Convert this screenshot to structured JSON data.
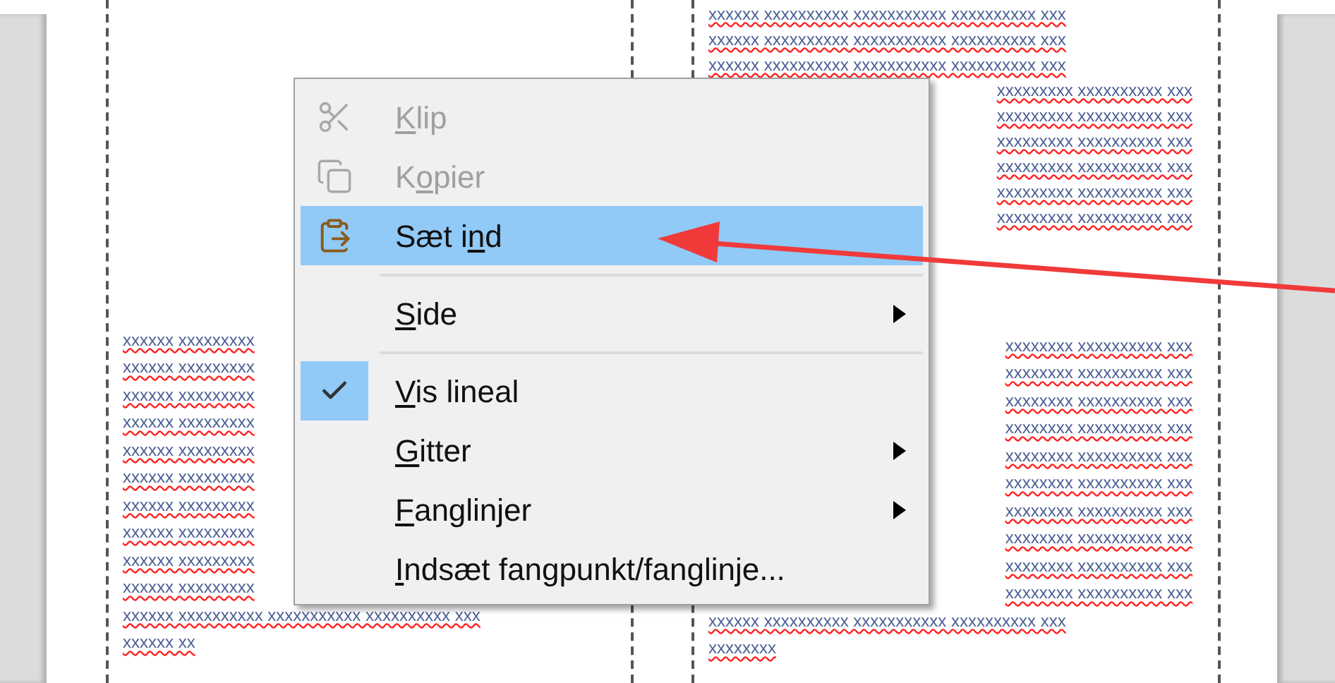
{
  "document": {
    "left_column": {
      "rows": [
        "xxxxxx xxxxxxxxx",
        "xxxxxx xxxxxxxxx",
        "xxxxxx xxxxxxxxx",
        "xxxxxx xxxxxxxxx",
        "xxxxxx xxxxxxxxx",
        "xxxxxx xxxxxxxxx",
        "xxxxxx xxxxxxxxx",
        "xxxxxx xxxxxxxxx",
        "xxxxxx xxxxxxxxx",
        "xxxxxx xxxxxxxxx",
        "xxxxxx xxxxxxxxxx xxxxxxxxxxx xxxxxxxxxx xxx",
        "xxxxxx xx"
      ]
    },
    "right_column": {
      "top_rows": [
        "xxxxxx xxxxxxxxxx xxxxxxxxxxx xxxxxxxxxx xxx",
        "xxxxxx xxxxxxxxxx xxxxxxxxxxx xxxxxxxxxx xxx",
        "xxxxxx xxxxxxxxxx xxxxxxxxxxx xxxxxxxxxx xxx",
        "xxxxxxxxx xxxxxxxxxx xxx",
        "xxxxxxxxx xxxxxxxxxx xxx",
        "xxxxxxxxx xxxxxxxxxx xxx",
        "xxxxxxxxx xxxxxxxxxx xxx",
        "xxxxxxxxx xxxxxxxxxx xxx",
        "xxxxxxxxx xxxxxxxxxx xxx"
      ],
      "bottom_rows": [
        "xxxxxxxx xxxxxxxxxx xxx",
        "xxxxxxxx xxxxxxxxxx xxx",
        "xxxxxxxx xxxxxxxxxx xxx",
        "xxxxxxxx xxxxxxxxxx xxx",
        "xxxxxxxx xxxxxxxxxx xxx",
        "xxxxxxxx xxxxxxxxxx xxx",
        "xxxxxxxx xxxxxxxxxx xxx",
        "xxxxxxxx xxxxxxxxxx xxx",
        "xxxxxxxx xxxxxxxxxx xxx",
        "xxxxxxxx xxxxxxxxxx xxx",
        "xxxxxx xxxxxxxxxx xxxxxxxxxxx xxxxxxxxxx xxx",
        "xxxxxxxx"
      ]
    }
  },
  "context_menu": {
    "items": [
      {
        "kind": "item",
        "label": {
          "key": "K",
          "after": "lip"
        },
        "disabled": true,
        "selected": false,
        "checked": false,
        "submenu": false
      },
      {
        "kind": "item",
        "label": {
          "before": "K",
          "key": "o",
          "after": "pier"
        },
        "disabled": true,
        "selected": false,
        "checked": false,
        "submenu": false
      },
      {
        "kind": "item",
        "label": {
          "before": "Sæt i",
          "key": "n",
          "after": "d"
        },
        "disabled": false,
        "selected": true,
        "checked": false,
        "submenu": false
      },
      {
        "kind": "separator"
      },
      {
        "kind": "item",
        "label": {
          "key": "S",
          "after": "ide"
        },
        "disabled": false,
        "selected": false,
        "checked": false,
        "submenu": true
      },
      {
        "kind": "separator"
      },
      {
        "kind": "item",
        "label": {
          "key": "V",
          "after": "is lineal"
        },
        "disabled": false,
        "selected": false,
        "checked": true,
        "submenu": false
      },
      {
        "kind": "item",
        "label": {
          "key": "G",
          "after": "itter"
        },
        "disabled": false,
        "selected": false,
        "checked": false,
        "submenu": true
      },
      {
        "kind": "item",
        "label": {
          "key": "F",
          "after": "anglinjer"
        },
        "disabled": false,
        "selected": false,
        "checked": false,
        "submenu": true
      },
      {
        "kind": "item",
        "label": {
          "key": "I",
          "after": "ndsæt fangpunkt/fanglinje..."
        },
        "disabled": false,
        "selected": false,
        "checked": false,
        "submenu": false
      }
    ]
  }
}
